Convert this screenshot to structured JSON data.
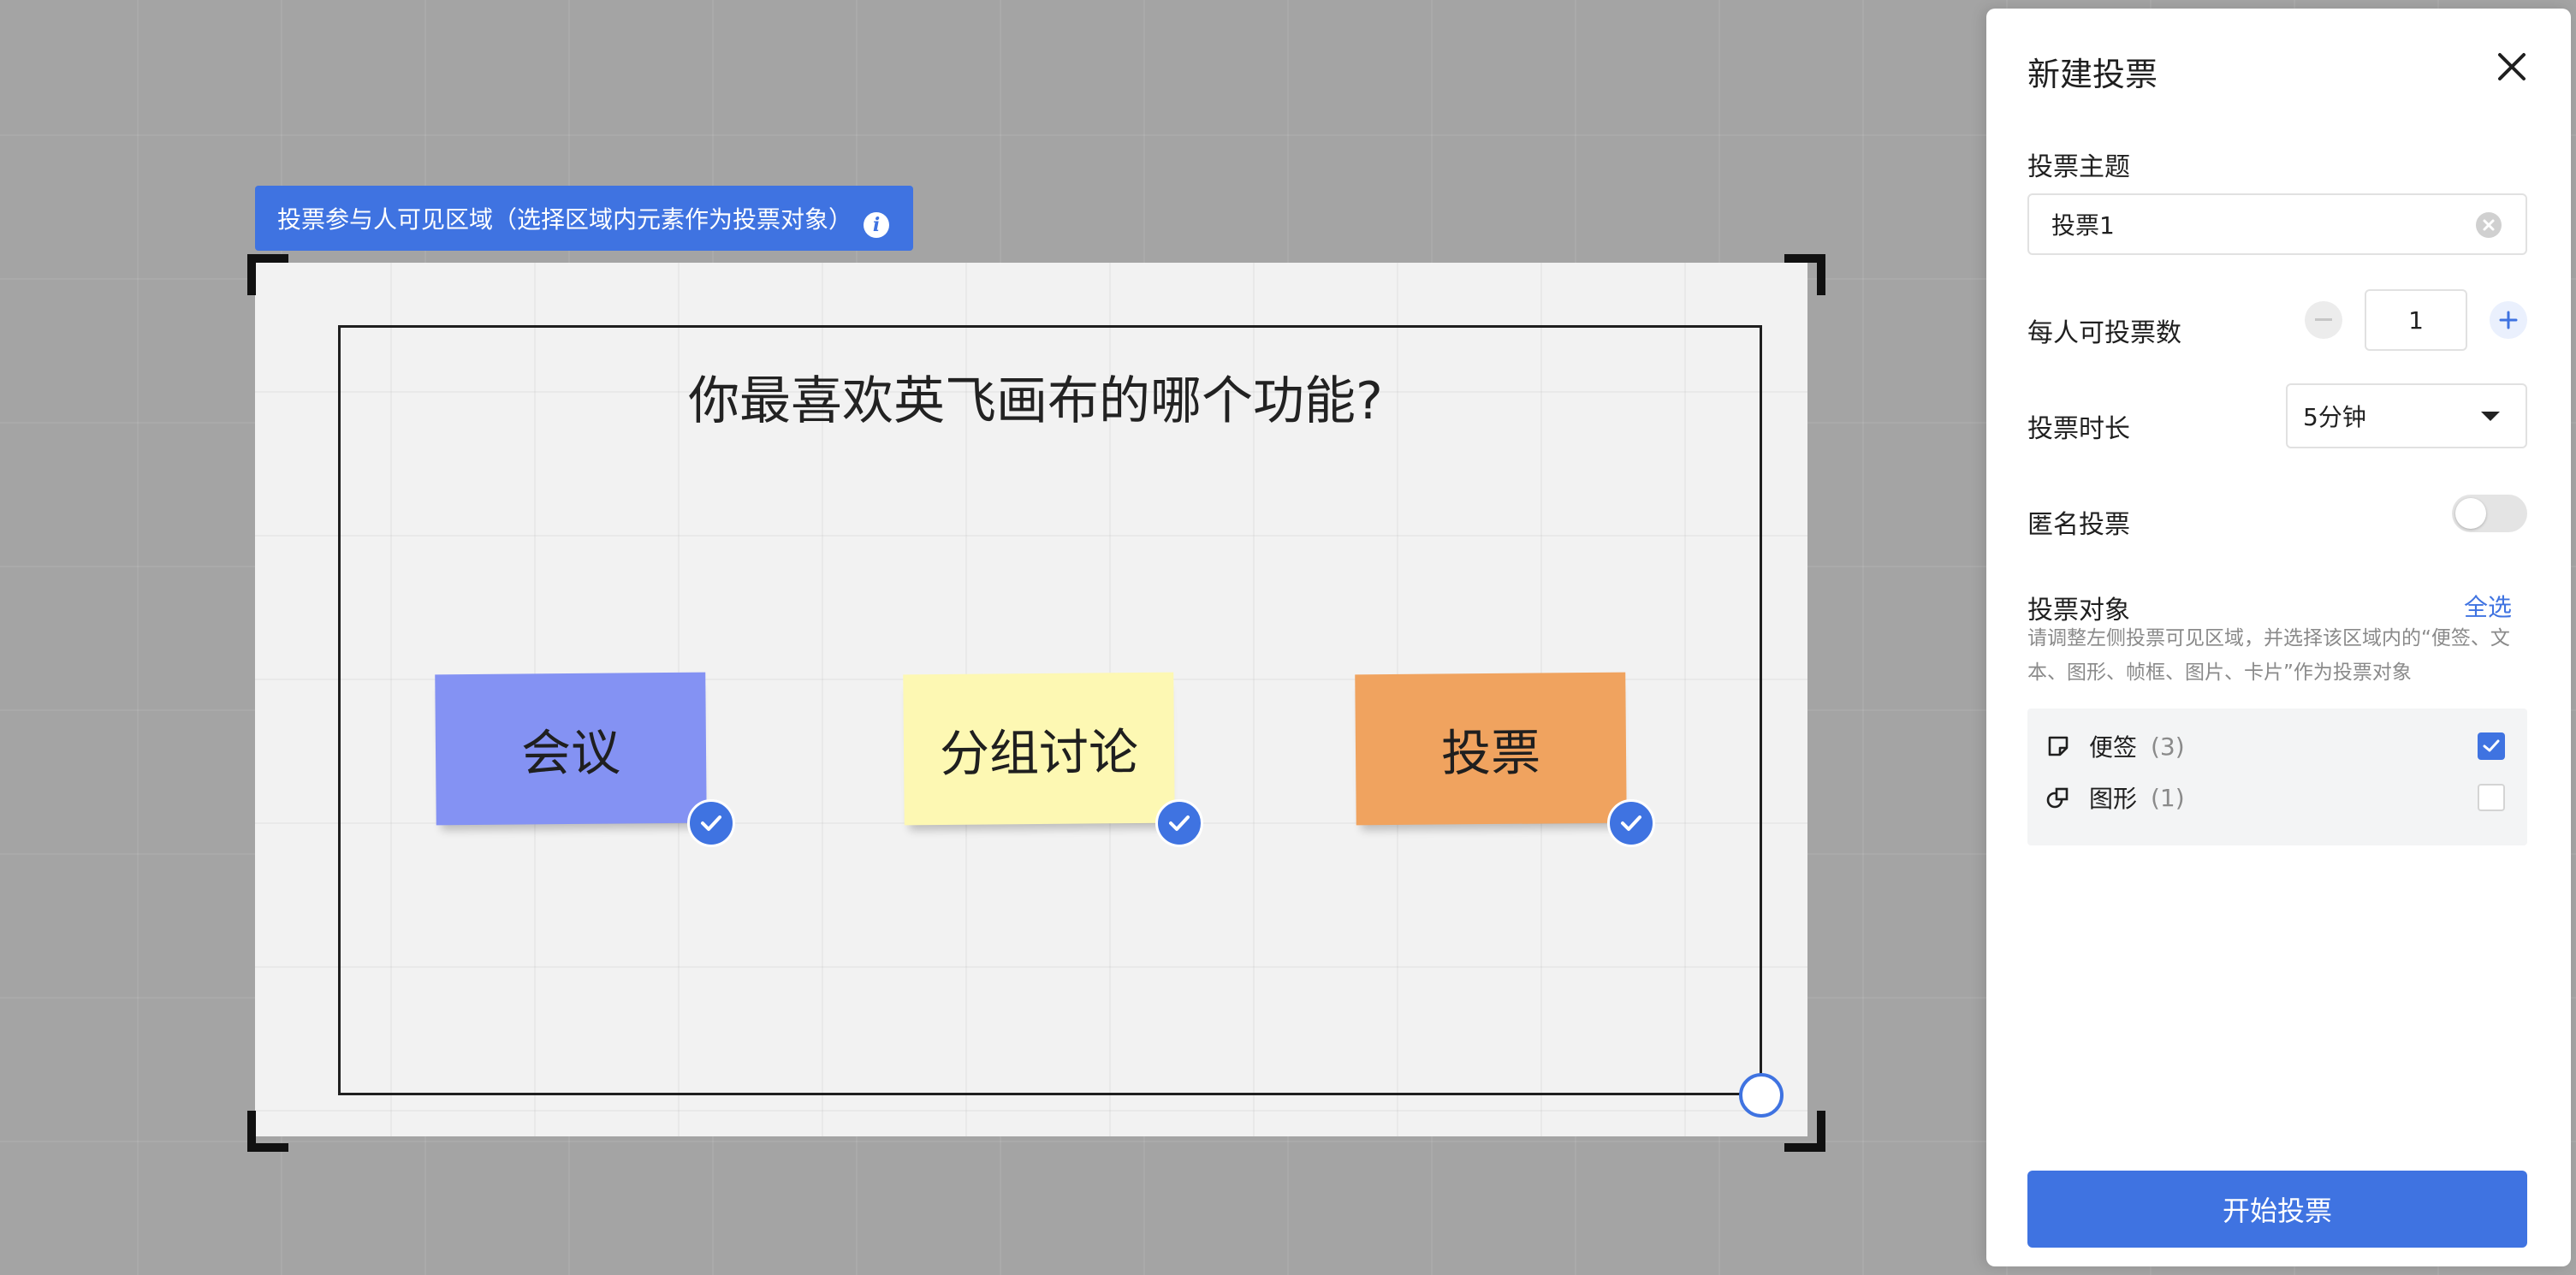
{
  "canvas": {
    "region_tag": {
      "label": "投票参与人可见区域（选择区域内元素作为投票对象）",
      "info_icon": "i"
    },
    "frame": {
      "title": "你最喜欢英飞画布的哪个功能?"
    },
    "notes": [
      {
        "label": "会议",
        "color": "#8492f3",
        "selected": true
      },
      {
        "label": "分组讨论",
        "color": "#fdf8b3",
        "selected": true
      },
      {
        "label": "投票",
        "color": "#f0a35f",
        "selected": true
      }
    ]
  },
  "panel": {
    "title": "新建投票",
    "close_icon": "close-icon",
    "topic": {
      "label": "投票主题",
      "value": "投票1"
    },
    "votes_per_person": {
      "label": "每人可投票数",
      "value": "1"
    },
    "duration": {
      "label": "投票时长",
      "value": "5分钟"
    },
    "anonymous": {
      "label": "匿名投票",
      "enabled": false
    },
    "targets": {
      "label": "投票对象",
      "select_all": "全选",
      "hint": "请调整左侧投票可见区域，并选择该区域内的“便签、文本、图形、帧框、图片、卡片”作为投票对象",
      "types": [
        {
          "name": "便签",
          "count": "(3)",
          "icon": "sticky-note-icon",
          "checked": true
        },
        {
          "name": "图形",
          "count": "(1)",
          "icon": "shape-icon",
          "checked": false
        }
      ]
    },
    "start_button": "开始投票"
  },
  "colors": {
    "accent": "#3f73e1",
    "canvas_background": "#a4a4a4"
  }
}
